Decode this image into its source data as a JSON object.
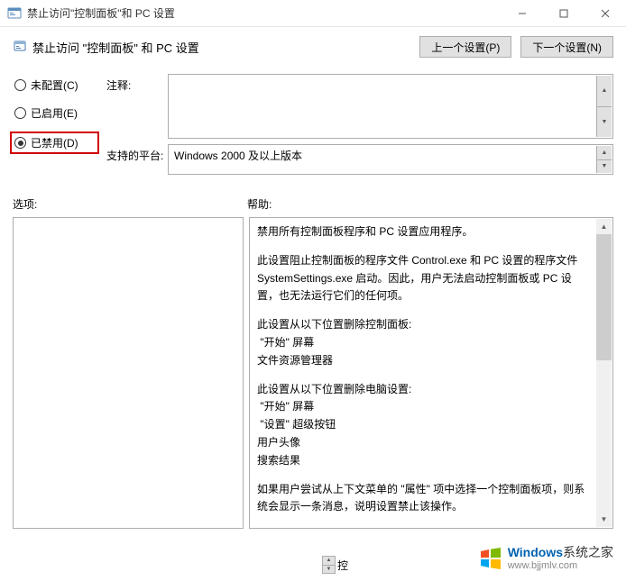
{
  "window": {
    "title": "禁止访问\"控制面板\"和 PC 设置",
    "minimize": "–",
    "maximize": "□",
    "close": "×"
  },
  "header": {
    "policy_title": "禁止访问 \"控制面板\" 和 PC 设置",
    "prev_btn": "上一个设置(P)",
    "next_btn": "下一个设置(N)"
  },
  "radios": {
    "not_configured": "未配置(C)",
    "enabled": "已启用(E)",
    "disabled": "已禁用(D)"
  },
  "fields": {
    "comment_label": "注释:",
    "platform_label": "支持的平台:",
    "platform_value": "Windows 2000 及以上版本"
  },
  "panes": {
    "options_label": "选项:",
    "help_label": "帮助:"
  },
  "help": {
    "p1": "禁用所有控制面板程序和 PC 设置应用程序。",
    "p2": "此设置阻止控制面板的程序文件 Control.exe 和 PC 设置的程序文件 SystemSettings.exe 启动。因此，用户无法启动控制面板或 PC 设置，也无法运行它们的任何项。",
    "p3": "此设置从以下位置删除控制面板:",
    "p3a": "\"开始\" 屏幕",
    "p3b": "文件资源管理器",
    "p4": "此设置从以下位置删除电脑设置:",
    "p4a": "\"开始\" 屏幕",
    "p4b": "\"设置\" 超级按钮",
    "p4c": "用户头像",
    "p4d": "搜索结果",
    "p5": "如果用户尝试从上下文菜单的 \"属性\" 项中选择一个控制面板项，则系统会显示一条消息，说明设置禁止该操作。"
  },
  "footer": {
    "label": "控"
  },
  "watermark": {
    "brand_a": "Windows",
    "brand_b": "系统之家",
    "url": "www.bjjmlv.com"
  }
}
